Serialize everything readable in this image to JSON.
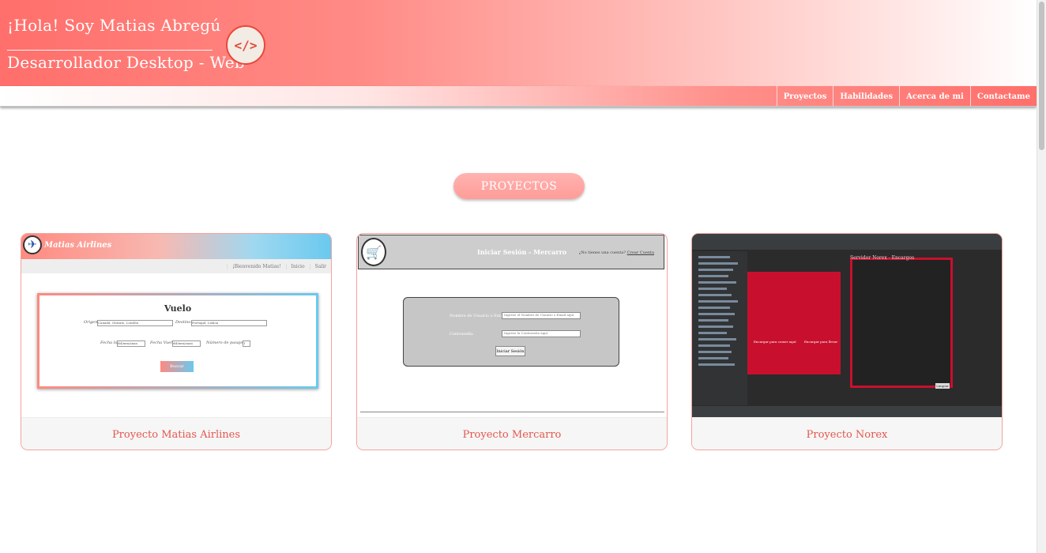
{
  "header": {
    "title": "¡Hola! Soy Matias Abregú",
    "subtitle": "Desarrollador Desktop - Web",
    "badge": "</>"
  },
  "nav": {
    "items": [
      "Proyectos",
      "Habilidades",
      "Acerca de mi",
      "Contactame"
    ]
  },
  "section": {
    "title": "PROYECTOS"
  },
  "projects": [
    {
      "title": "Proyecto Matias Airlines",
      "preview": {
        "brand": "Matias Airlines",
        "welcome": "¡Bienvenido Matias!",
        "menu": [
          "Inicio",
          "Salir"
        ],
        "form_title": "Vuelo",
        "origin_label": "Origen:",
        "origin_value": "Canadá, Ontario, Londón",
        "destination_label": "Destino:",
        "destination_value": "Portugal, Lisboa",
        "departure_label": "Fecha Ida:",
        "return_label": "Fecha Vuelta:",
        "date_placeholder": "dd/mm/aaaa",
        "passengers_label": "Número de pasajeros:",
        "passengers_value": "1",
        "button": "Buscar"
      }
    },
    {
      "title": "Proyecto Mercarro",
      "preview": {
        "heading": "Iniciar Sesión - Mercarro",
        "no_account": "¿No tienes una cuenta?",
        "create_account": "Crear Cuenta",
        "user_label": "Nombre de Usuario o Email:",
        "user_placeholder": "Ingrese el Nombre de Usuario o Email aquí",
        "password_label": "Contraseña:",
        "password_placeholder": "Ingrese la Contraseña aquí",
        "button": "Iniciar Sesión"
      }
    },
    {
      "title": "Proyecto Norex",
      "preview": {
        "dialog_title": "Servidor Norex - Encargos",
        "option_left": "Encargar para comer aquí",
        "option_right": "Encargar para llevar",
        "button": "Limpiar"
      }
    }
  ]
}
